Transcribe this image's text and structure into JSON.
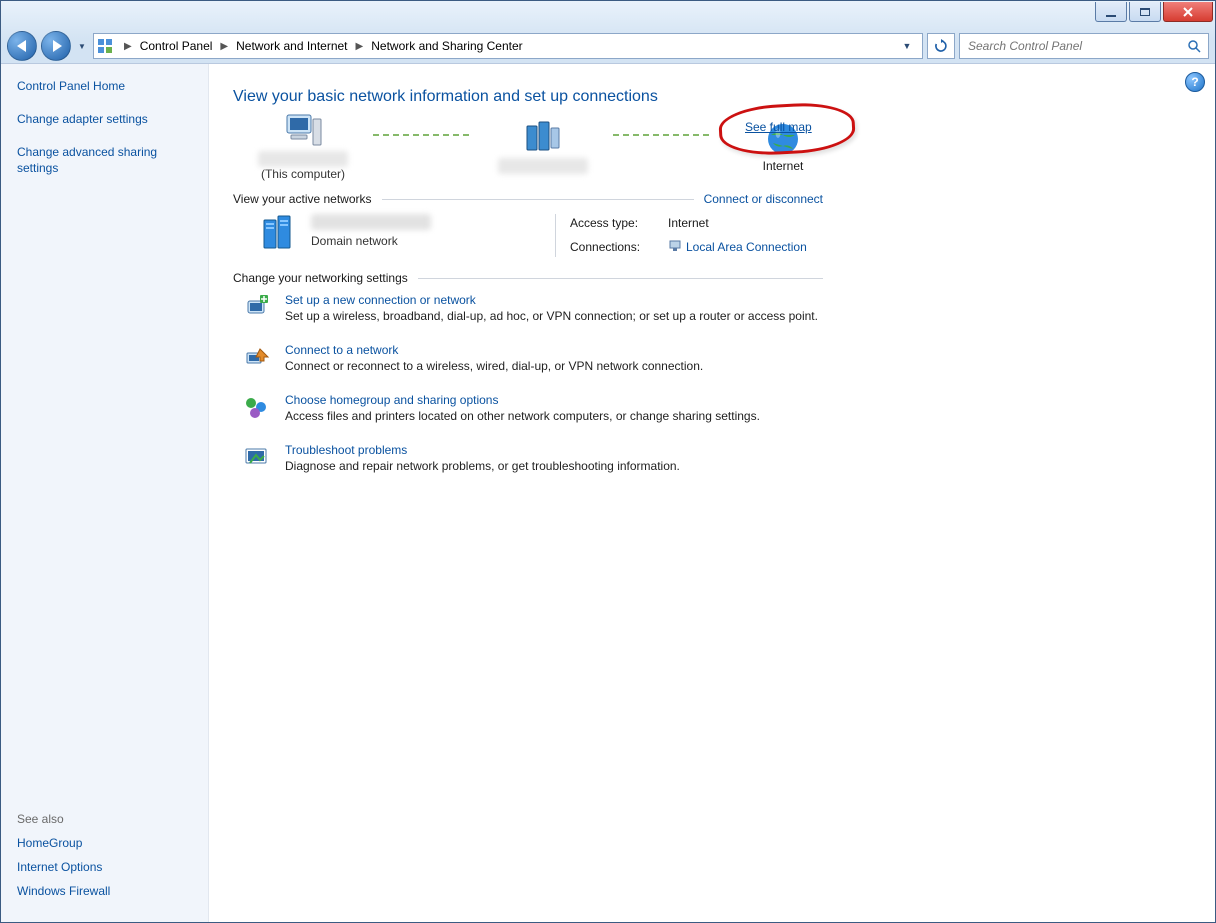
{
  "breadcrumb": {
    "items": [
      "Control Panel",
      "Network and Internet",
      "Network and Sharing Center"
    ]
  },
  "search": {
    "placeholder": "Search Control Panel"
  },
  "sidebar": {
    "home": "Control Panel Home",
    "links": [
      "Change adapter settings",
      "Change advanced sharing settings"
    ],
    "see_also_hdr": "See also",
    "see_also": [
      "HomeGroup",
      "Internet Options",
      "Windows Firewall"
    ]
  },
  "main": {
    "title": "View your basic network information and set up connections",
    "map": {
      "this_computer_caption": "(This computer)",
      "internet_caption": "Internet",
      "see_full_map": "See full map"
    },
    "active_hdr": "View your active networks",
    "connect_disconnect": "Connect or disconnect",
    "network_type": "Domain network",
    "access_type_label": "Access type:",
    "access_type_value": "Internet",
    "connections_label": "Connections:",
    "connection_link": "Local Area Connection",
    "settings_hdr": "Change your networking settings",
    "settings": [
      {
        "title": "Set up a new connection or network",
        "desc": "Set up a wireless, broadband, dial-up, ad hoc, or VPN connection; or set up a router or access point."
      },
      {
        "title": "Connect to a network",
        "desc": "Connect or reconnect to a wireless, wired, dial-up, or VPN network connection."
      },
      {
        "title": "Choose homegroup and sharing options",
        "desc": "Access files and printers located on other network computers, or change sharing settings."
      },
      {
        "title": "Troubleshoot problems",
        "desc": "Diagnose and repair network problems, or get troubleshooting information."
      }
    ]
  }
}
